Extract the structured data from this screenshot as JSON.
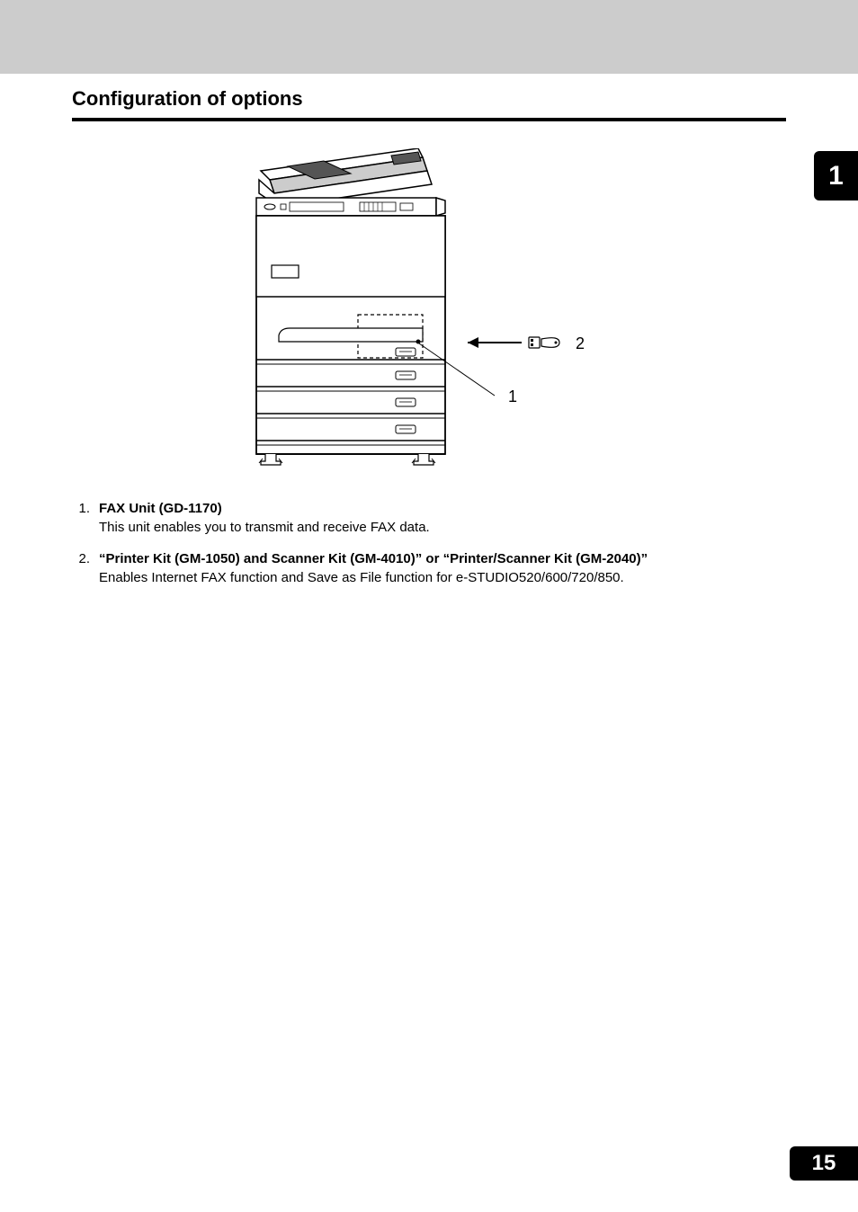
{
  "section_title": "Configuration of options",
  "chapter_number": "1",
  "page_number": "15",
  "callouts": {
    "label_1": "1",
    "label_2": "2"
  },
  "options": [
    {
      "number": "1.",
      "title": "FAX Unit (GD-1170)",
      "description": "This unit enables you to transmit and receive FAX data."
    },
    {
      "number": "2.",
      "title": "“Printer Kit (GM-1050) and Scanner Kit (GM-4010)” or “Printer/Scanner Kit (GM-2040)”",
      "description": "Enables Internet FAX function and Save as File function for e-STUDIO520/600/720/850."
    }
  ]
}
